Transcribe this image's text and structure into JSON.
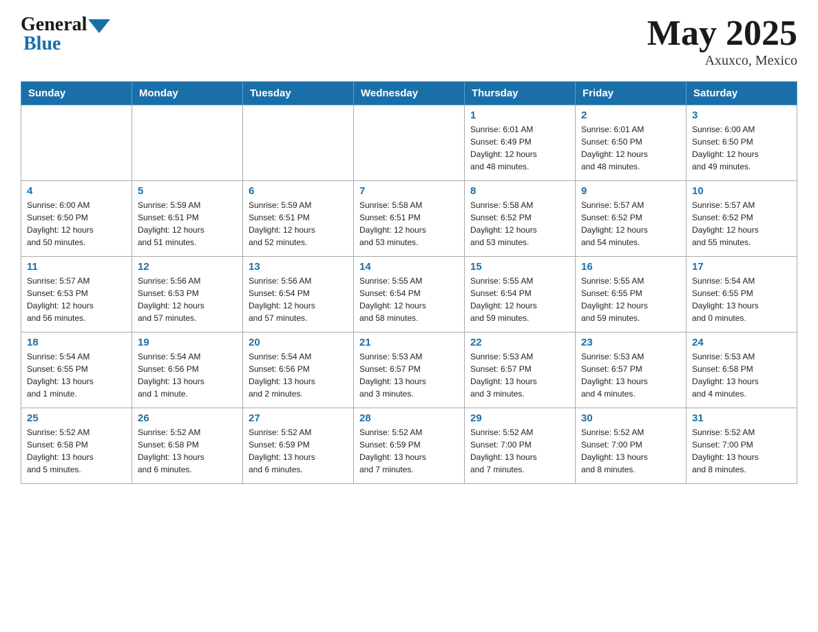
{
  "header": {
    "logo_general": "General",
    "logo_blue": "Blue",
    "month_year": "May 2025",
    "location": "Axuxco, Mexico"
  },
  "days_of_week": [
    "Sunday",
    "Monday",
    "Tuesday",
    "Wednesday",
    "Thursday",
    "Friday",
    "Saturday"
  ],
  "weeks": [
    [
      {
        "day": "",
        "info": ""
      },
      {
        "day": "",
        "info": ""
      },
      {
        "day": "",
        "info": ""
      },
      {
        "day": "",
        "info": ""
      },
      {
        "day": "1",
        "info": "Sunrise: 6:01 AM\nSunset: 6:49 PM\nDaylight: 12 hours\nand 48 minutes."
      },
      {
        "day": "2",
        "info": "Sunrise: 6:01 AM\nSunset: 6:50 PM\nDaylight: 12 hours\nand 48 minutes."
      },
      {
        "day": "3",
        "info": "Sunrise: 6:00 AM\nSunset: 6:50 PM\nDaylight: 12 hours\nand 49 minutes."
      }
    ],
    [
      {
        "day": "4",
        "info": "Sunrise: 6:00 AM\nSunset: 6:50 PM\nDaylight: 12 hours\nand 50 minutes."
      },
      {
        "day": "5",
        "info": "Sunrise: 5:59 AM\nSunset: 6:51 PM\nDaylight: 12 hours\nand 51 minutes."
      },
      {
        "day": "6",
        "info": "Sunrise: 5:59 AM\nSunset: 6:51 PM\nDaylight: 12 hours\nand 52 minutes."
      },
      {
        "day": "7",
        "info": "Sunrise: 5:58 AM\nSunset: 6:51 PM\nDaylight: 12 hours\nand 53 minutes."
      },
      {
        "day": "8",
        "info": "Sunrise: 5:58 AM\nSunset: 6:52 PM\nDaylight: 12 hours\nand 53 minutes."
      },
      {
        "day": "9",
        "info": "Sunrise: 5:57 AM\nSunset: 6:52 PM\nDaylight: 12 hours\nand 54 minutes."
      },
      {
        "day": "10",
        "info": "Sunrise: 5:57 AM\nSunset: 6:52 PM\nDaylight: 12 hours\nand 55 minutes."
      }
    ],
    [
      {
        "day": "11",
        "info": "Sunrise: 5:57 AM\nSunset: 6:53 PM\nDaylight: 12 hours\nand 56 minutes."
      },
      {
        "day": "12",
        "info": "Sunrise: 5:56 AM\nSunset: 6:53 PM\nDaylight: 12 hours\nand 57 minutes."
      },
      {
        "day": "13",
        "info": "Sunrise: 5:56 AM\nSunset: 6:54 PM\nDaylight: 12 hours\nand 57 minutes."
      },
      {
        "day": "14",
        "info": "Sunrise: 5:55 AM\nSunset: 6:54 PM\nDaylight: 12 hours\nand 58 minutes."
      },
      {
        "day": "15",
        "info": "Sunrise: 5:55 AM\nSunset: 6:54 PM\nDaylight: 12 hours\nand 59 minutes."
      },
      {
        "day": "16",
        "info": "Sunrise: 5:55 AM\nSunset: 6:55 PM\nDaylight: 12 hours\nand 59 minutes."
      },
      {
        "day": "17",
        "info": "Sunrise: 5:54 AM\nSunset: 6:55 PM\nDaylight: 13 hours\nand 0 minutes."
      }
    ],
    [
      {
        "day": "18",
        "info": "Sunrise: 5:54 AM\nSunset: 6:55 PM\nDaylight: 13 hours\nand 1 minute."
      },
      {
        "day": "19",
        "info": "Sunrise: 5:54 AM\nSunset: 6:56 PM\nDaylight: 13 hours\nand 1 minute."
      },
      {
        "day": "20",
        "info": "Sunrise: 5:54 AM\nSunset: 6:56 PM\nDaylight: 13 hours\nand 2 minutes."
      },
      {
        "day": "21",
        "info": "Sunrise: 5:53 AM\nSunset: 6:57 PM\nDaylight: 13 hours\nand 3 minutes."
      },
      {
        "day": "22",
        "info": "Sunrise: 5:53 AM\nSunset: 6:57 PM\nDaylight: 13 hours\nand 3 minutes."
      },
      {
        "day": "23",
        "info": "Sunrise: 5:53 AM\nSunset: 6:57 PM\nDaylight: 13 hours\nand 4 minutes."
      },
      {
        "day": "24",
        "info": "Sunrise: 5:53 AM\nSunset: 6:58 PM\nDaylight: 13 hours\nand 4 minutes."
      }
    ],
    [
      {
        "day": "25",
        "info": "Sunrise: 5:52 AM\nSunset: 6:58 PM\nDaylight: 13 hours\nand 5 minutes."
      },
      {
        "day": "26",
        "info": "Sunrise: 5:52 AM\nSunset: 6:58 PM\nDaylight: 13 hours\nand 6 minutes."
      },
      {
        "day": "27",
        "info": "Sunrise: 5:52 AM\nSunset: 6:59 PM\nDaylight: 13 hours\nand 6 minutes."
      },
      {
        "day": "28",
        "info": "Sunrise: 5:52 AM\nSunset: 6:59 PM\nDaylight: 13 hours\nand 7 minutes."
      },
      {
        "day": "29",
        "info": "Sunrise: 5:52 AM\nSunset: 7:00 PM\nDaylight: 13 hours\nand 7 minutes."
      },
      {
        "day": "30",
        "info": "Sunrise: 5:52 AM\nSunset: 7:00 PM\nDaylight: 13 hours\nand 8 minutes."
      },
      {
        "day": "31",
        "info": "Sunrise: 5:52 AM\nSunset: 7:00 PM\nDaylight: 13 hours\nand 8 minutes."
      }
    ]
  ]
}
